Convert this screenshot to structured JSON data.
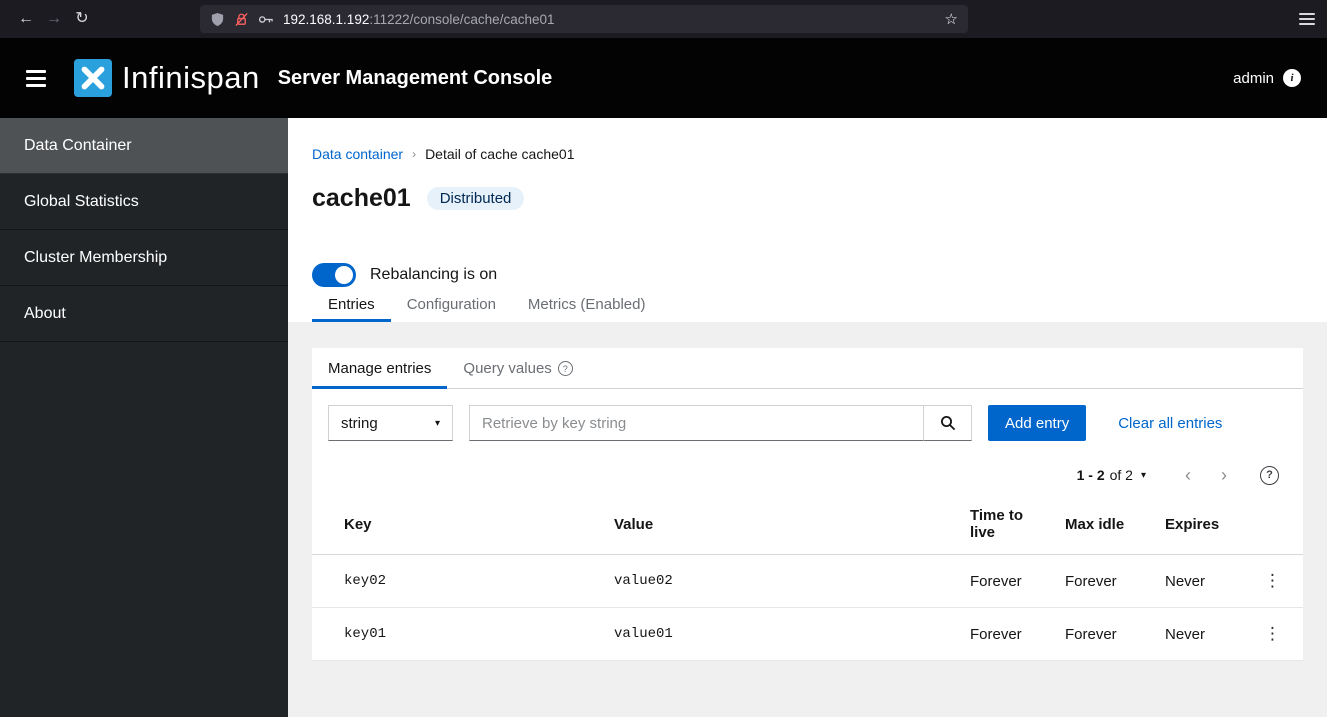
{
  "browser": {
    "url_domain": "192.168.1.192",
    "url_rest": ":11222/console/cache/cache01"
  },
  "masthead": {
    "brand": "Infinispan",
    "title": "Server Management Console",
    "user": "admin"
  },
  "sidebar": {
    "items": [
      {
        "label": "Data Container",
        "active": true
      },
      {
        "label": "Global Statistics",
        "active": false
      },
      {
        "label": "Cluster Membership",
        "active": false
      },
      {
        "label": "About",
        "active": false
      }
    ]
  },
  "breadcrumb": {
    "parent": "Data container",
    "current": "Detail of cache cache01"
  },
  "cache": {
    "name": "cache01",
    "type_badge": "Distributed",
    "rebalancing_label": "Rebalancing is on"
  },
  "tabs": {
    "entries": "Entries",
    "configuration": "Configuration",
    "metrics": "Metrics (Enabled)"
  },
  "card": {
    "tab_manage": "Manage entries",
    "tab_query": "Query values",
    "key_type": "string",
    "search_placeholder": "Retrieve by key string",
    "add_entry": "Add entry",
    "clear_all": "Clear all entries",
    "pagination": {
      "range_current": "1 - 2",
      "range_of": "of 2"
    }
  },
  "table": {
    "headers": {
      "key": "Key",
      "value": "Value",
      "ttl": "Time to live",
      "max_idle": "Max idle",
      "expires": "Expires"
    },
    "rows": [
      {
        "key": "key02",
        "value": "value02",
        "ttl": "Forever",
        "max_idle": "Forever",
        "expires": "Never"
      },
      {
        "key": "key01",
        "value": "value01",
        "ttl": "Forever",
        "max_idle": "Forever",
        "expires": "Never"
      }
    ]
  },
  "icons": {
    "back": "←",
    "forward": "→",
    "reload": "↻",
    "star": "☆",
    "caret_down": "▾",
    "breadcrumb_sep": "›",
    "chevron_left": "‹",
    "chevron_right": "›",
    "question": "?",
    "info": "i",
    "kebab": "⋮"
  },
  "colors": {
    "accent": "#0066cc",
    "masthead_bg": "#030303",
    "sidebar_bg": "#212427",
    "sidebar_active_bg": "#4f5255",
    "badge_bg": "#e7f1fa",
    "badge_text": "#002952",
    "page_bg": "#f0f0f0",
    "logo_blue": "#2aa0dd"
  }
}
